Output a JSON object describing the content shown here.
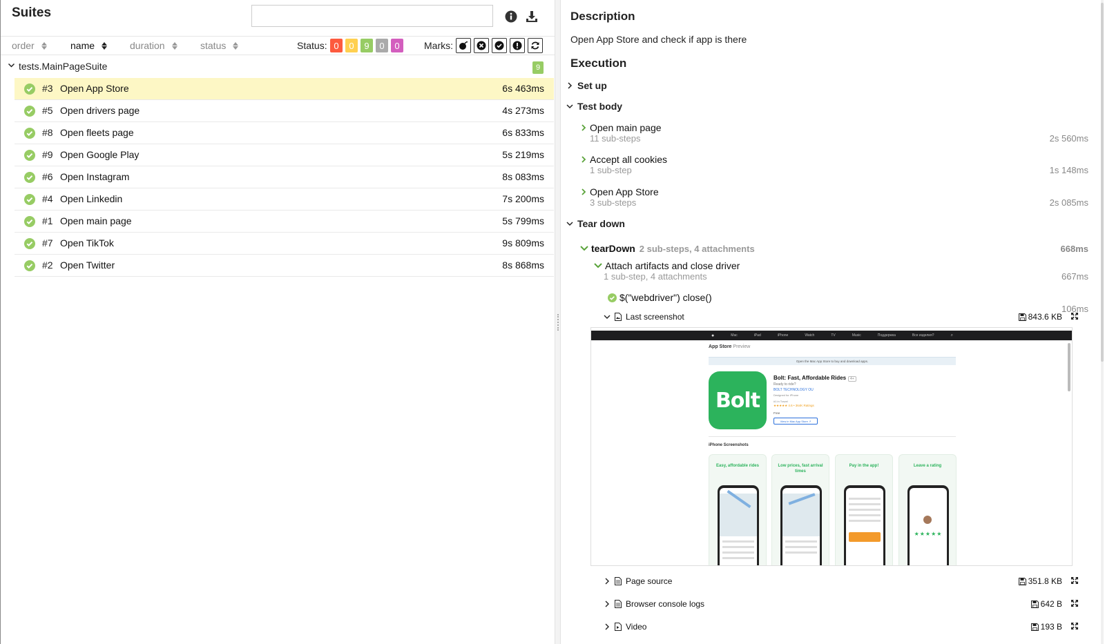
{
  "left": {
    "title": "Suites",
    "search": {
      "value": "",
      "placeholder": ""
    },
    "icons": {
      "info": "info-circle-icon",
      "download": "download-icon"
    },
    "sort_columns": [
      {
        "label": "order",
        "active": false
      },
      {
        "label": "name",
        "active": true
      },
      {
        "label": "duration",
        "active": false
      },
      {
        "label": "status",
        "active": false
      }
    ],
    "status_label": "Status:",
    "status_counts": [
      {
        "key": "failed",
        "value": "0",
        "color": "#fd5a3e"
      },
      {
        "key": "broken",
        "value": "0",
        "color": "#ffd050"
      },
      {
        "key": "passed",
        "value": "9",
        "color": "#97cc64"
      },
      {
        "key": "skipped",
        "value": "0",
        "color": "#aaaaaa"
      },
      {
        "key": "unknown",
        "value": "0",
        "color": "#d35ebe"
      }
    ],
    "marks_label": "Marks:",
    "marks": [
      "bomb-icon",
      "times-circle-icon",
      "check-circle-icon",
      "exclamation-circle-icon",
      "refresh-icon"
    ],
    "suite": {
      "name": "tests.MainPageSuite",
      "count": "9"
    },
    "tests": [
      {
        "num": "#3",
        "name": "Open App Store",
        "duration": "6s 463ms",
        "selected": true
      },
      {
        "num": "#5",
        "name": "Open drivers page",
        "duration": "4s 273ms"
      },
      {
        "num": "#8",
        "name": "Open fleets page",
        "duration": "6s 833ms"
      },
      {
        "num": "#9",
        "name": "Open Google Play",
        "duration": "5s 219ms"
      },
      {
        "num": "#6",
        "name": "Open Instagram",
        "duration": "8s 083ms"
      },
      {
        "num": "#4",
        "name": "Open Linkedin",
        "duration": "7s 200ms"
      },
      {
        "num": "#1",
        "name": "Open main page",
        "duration": "5s 799ms"
      },
      {
        "num": "#7",
        "name": "Open TikTok",
        "duration": "9s 809ms"
      },
      {
        "num": "#2",
        "name": "Open Twitter",
        "duration": "8s 868ms"
      }
    ]
  },
  "right": {
    "description_heading": "Description",
    "description_text": "Open App Store and check if app is there",
    "execution_heading": "Execution",
    "setup_label": "Set up",
    "testbody_label": "Test body",
    "body_steps": [
      {
        "title": "Open main page",
        "sub": "11 sub-steps",
        "duration": "2s 560ms"
      },
      {
        "title": "Accept all cookies",
        "sub": "1 sub-step",
        "duration": "1s 148ms"
      },
      {
        "title": "Open App Store",
        "sub": "3 sub-steps",
        "duration": "2s 085ms"
      }
    ],
    "teardown_label": "Tear down",
    "teardown_step": {
      "title": "tearDown",
      "sub": "2 sub-steps, 4 attachments",
      "duration": "668ms"
    },
    "attach_step": {
      "title": "Attach artifacts and close driver",
      "sub": "1 sub-step, 4 attachments",
      "duration": "667ms"
    },
    "close_step": {
      "title": "$(\"webdriver\") close()",
      "duration": "106ms"
    },
    "attachments": [
      {
        "name": "Last screenshot",
        "size": "843.6 KB",
        "expanded": true
      },
      {
        "name": "Page source",
        "size": "351.8 KB"
      },
      {
        "name": "Browser console logs",
        "size": "642 B"
      },
      {
        "name": "Video",
        "size": "193 B"
      }
    ],
    "screenshot": {
      "nav_items": [
        "Mac",
        "iPad",
        "iPhone",
        "Watch",
        "TV",
        "Music",
        "Поддержка",
        "Все изделия?"
      ],
      "store_title": "App Store",
      "store_sub": "Preview",
      "banner": "Open the Mac App Store to buy and download apps.",
      "logo_text": "Bolt",
      "app_name": "Bolt: Fast, Affordable Rides",
      "age": "4+",
      "tagline": "Ready to ride?",
      "developer": "BOLT TECHNOLOGY OU",
      "designed": "Designed for iPhone",
      "rank": "#1 in Travel",
      "stars": "★★★★★ 4.6 • 364K Ratings",
      "price": "Free",
      "view_button": "View in Mac App Store ↗",
      "screens_heading": "iPhone Screenshots",
      "cards": [
        "Easy, affordable rides",
        "Low prices, fast arrival times",
        "Pay in the app!",
        "Leave a rating"
      ]
    }
  }
}
